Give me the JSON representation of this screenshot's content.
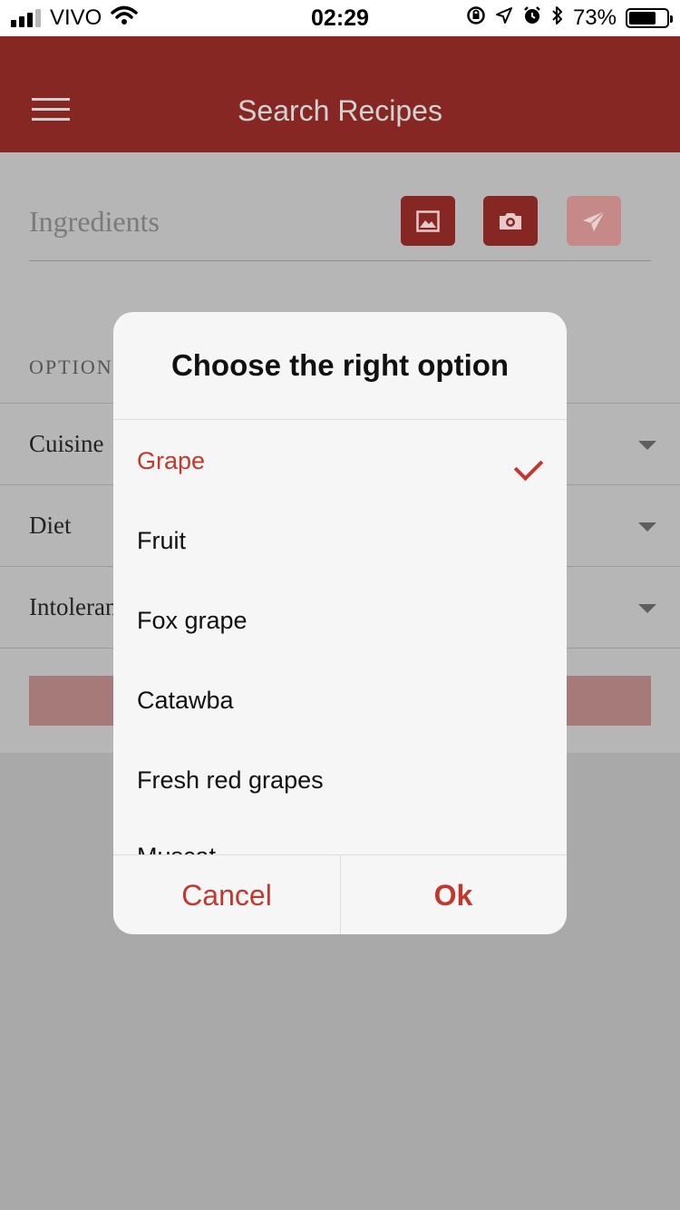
{
  "status_bar": {
    "carrier": "VIVO",
    "time": "02:29",
    "battery_percent": "73%",
    "battery_level": 0.73,
    "icons": [
      "signal-icon",
      "wifi-icon",
      "orientation-lock-icon",
      "location-icon",
      "alarm-icon",
      "bluetooth-icon",
      "battery-icon"
    ]
  },
  "header": {
    "title": "Search Recipes",
    "menu_icon": "hamburger-menu-icon",
    "color": "#862723"
  },
  "search": {
    "ingredients_placeholder": "Ingredients",
    "buttons": [
      {
        "icon": "image-icon",
        "enabled": true
      },
      {
        "icon": "camera-icon",
        "enabled": true
      },
      {
        "icon": "send-icon",
        "enabled": false
      }
    ]
  },
  "options": {
    "section_label": "OPTION",
    "rows": [
      {
        "label": "Cuisine"
      },
      {
        "label": "Diet"
      },
      {
        "label": "Intoleran"
      }
    ]
  },
  "dialog": {
    "title": "Choose the right option",
    "items": [
      {
        "label": "Grape",
        "selected": true
      },
      {
        "label": "Fruit",
        "selected": false
      },
      {
        "label": "Fox grape",
        "selected": false
      },
      {
        "label": "Catawba",
        "selected": false
      },
      {
        "label": "Fresh red grapes",
        "selected": false
      },
      {
        "label": "Muscat",
        "selected": false
      }
    ],
    "cancel_label": "Cancel",
    "ok_label": "Ok",
    "accent_color": "#c2382f"
  }
}
